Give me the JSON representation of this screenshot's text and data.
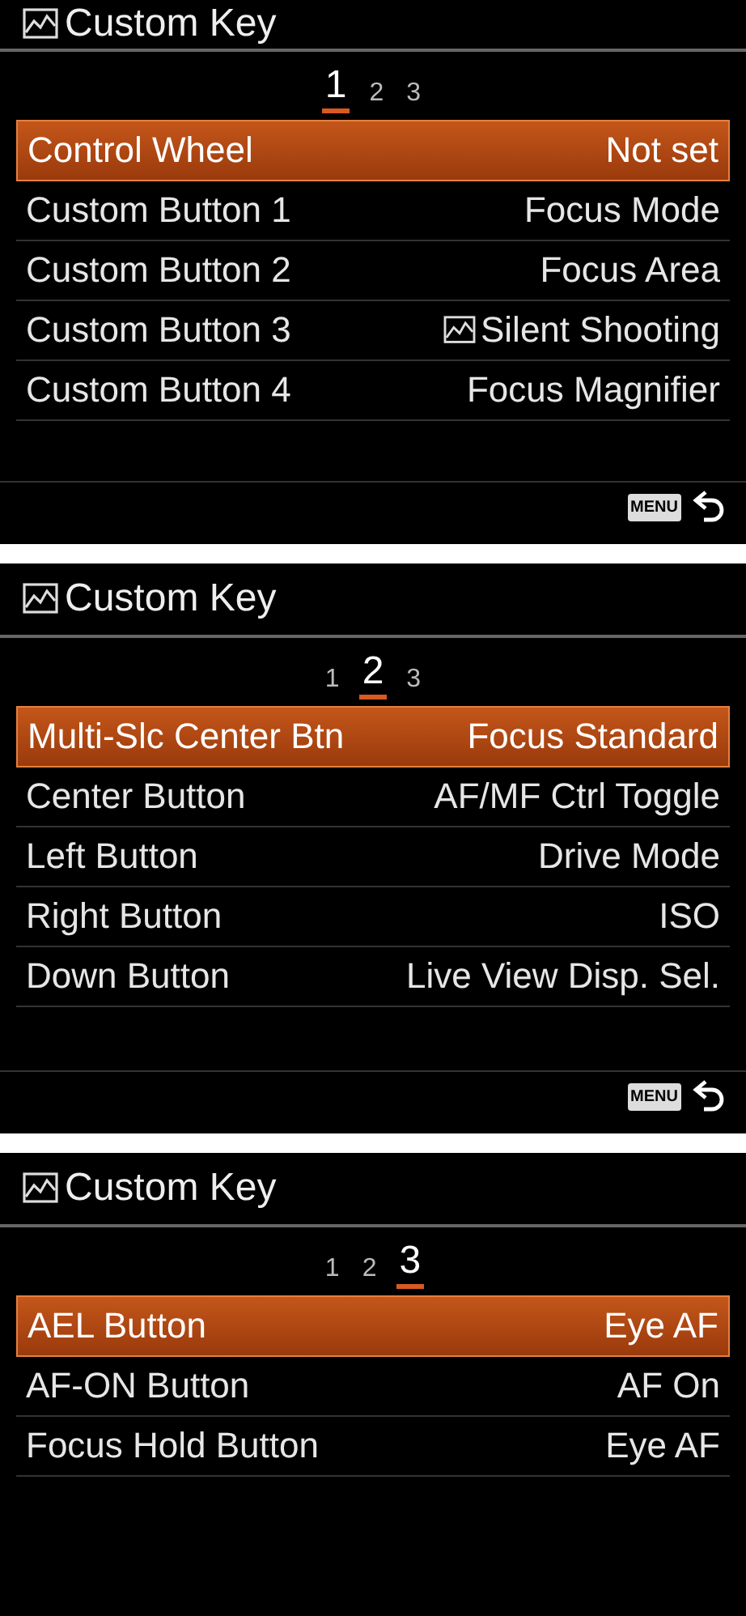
{
  "panels": [
    {
      "title": "Custom Key",
      "pages": [
        {
          "label": "1",
          "selected": true
        },
        {
          "label": "2",
          "selected": false
        },
        {
          "label": "3",
          "selected": false
        }
      ],
      "rows": [
        {
          "label": "Control Wheel",
          "value": "Not set",
          "selected": true
        },
        {
          "label": "Custom Button 1",
          "value": "Focus Mode",
          "selected": false
        },
        {
          "label": "Custom Button 2",
          "value": "Focus Area",
          "selected": false
        },
        {
          "label": "Custom Button 3",
          "value": "Silent Shooting",
          "value_icon": true,
          "selected": false
        },
        {
          "label": "Custom Button 4",
          "value": "Focus Magnifier",
          "selected": false
        }
      ],
      "footer": {
        "menu_key": "MENU"
      }
    },
    {
      "title": "Custom Key",
      "pages": [
        {
          "label": "1",
          "selected": false
        },
        {
          "label": "2",
          "selected": true
        },
        {
          "label": "3",
          "selected": false
        }
      ],
      "rows": [
        {
          "label": "Multi-Slc Center Btn",
          "value": "Focus Standard",
          "selected": true
        },
        {
          "label": "Center Button",
          "value": "AF/MF Ctrl Toggle",
          "selected": false
        },
        {
          "label": "Left Button",
          "value": "Drive Mode",
          "selected": false
        },
        {
          "label": "Right Button",
          "value": "ISO",
          "selected": false
        },
        {
          "label": "Down Button",
          "value": "Live View Disp. Sel.",
          "selected": false
        }
      ],
      "footer": {
        "menu_key": "MENU"
      }
    },
    {
      "title": "Custom Key",
      "pages": [
        {
          "label": "1",
          "selected": false
        },
        {
          "label": "2",
          "selected": false
        },
        {
          "label": "3",
          "selected": true
        }
      ],
      "rows": [
        {
          "label": "AEL Button",
          "value": "Eye AF",
          "selected": true
        },
        {
          "label": "AF-ON Button",
          "value": "AF On",
          "selected": false
        },
        {
          "label": "Focus Hold Button",
          "value": "Eye AF",
          "selected": false
        }
      ]
    }
  ]
}
